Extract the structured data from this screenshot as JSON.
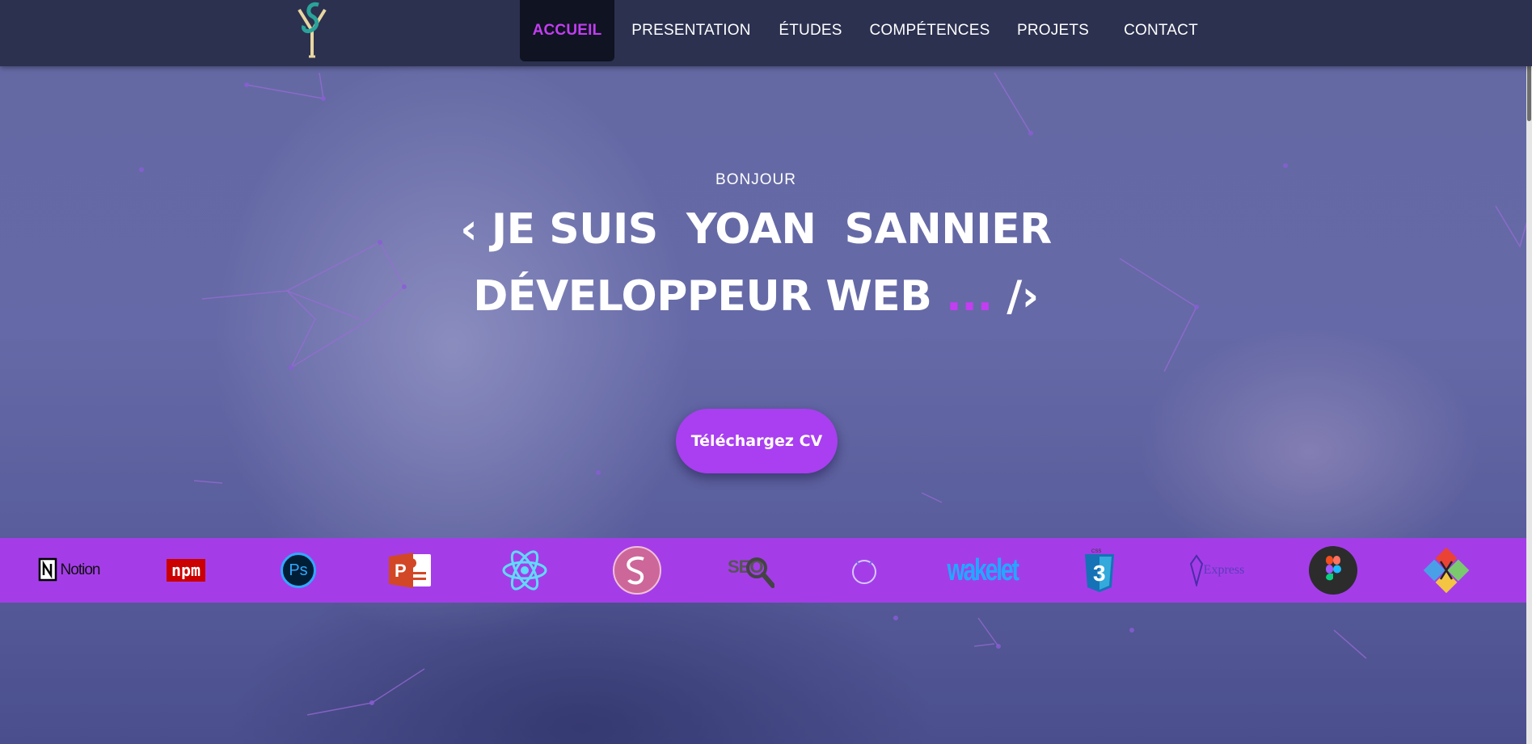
{
  "nav": {
    "logo_alt": "YS",
    "items": [
      "ACCUEIL",
      "PRESENTATION",
      "ÉTUDES",
      "COMPÉTENCES",
      "PROJETS",
      "CONTACT"
    ],
    "active": "ACCUEIL",
    "active_color": "#c23ef0"
  },
  "hero": {
    "greeting": "BONJOUR",
    "line1": "‹ JE SUIS  YOAN  SANNIER",
    "line2_text": "DÉVELOPPEUR WEB ",
    "line2_dots": "...",
    "line2_end": " /›",
    "cta_label": "Téléchargez CV",
    "accent_color": "#a93ff0"
  },
  "tech_strip": {
    "background": "#a43de8",
    "icons": [
      {
        "name": "notion-icon",
        "label": "Notion"
      },
      {
        "name": "npm-icon",
        "label": "npm"
      },
      {
        "name": "photoshop-icon",
        "label": "Ps"
      },
      {
        "name": "powerpoint-icon",
        "label": "P"
      },
      {
        "name": "react-icon",
        "label": ""
      },
      {
        "name": "sass-icon",
        "label": ""
      },
      {
        "name": "seo-icon",
        "label": "SEO"
      },
      {
        "name": "circle-icon",
        "label": ""
      },
      {
        "name": "wakelet-icon",
        "label": "wakelet"
      },
      {
        "name": "css3-icon",
        "label": "3"
      },
      {
        "name": "express-icon",
        "label": "Express"
      },
      {
        "name": "figma-icon",
        "label": ""
      },
      {
        "name": "git-tools-icon",
        "label": ""
      }
    ]
  }
}
